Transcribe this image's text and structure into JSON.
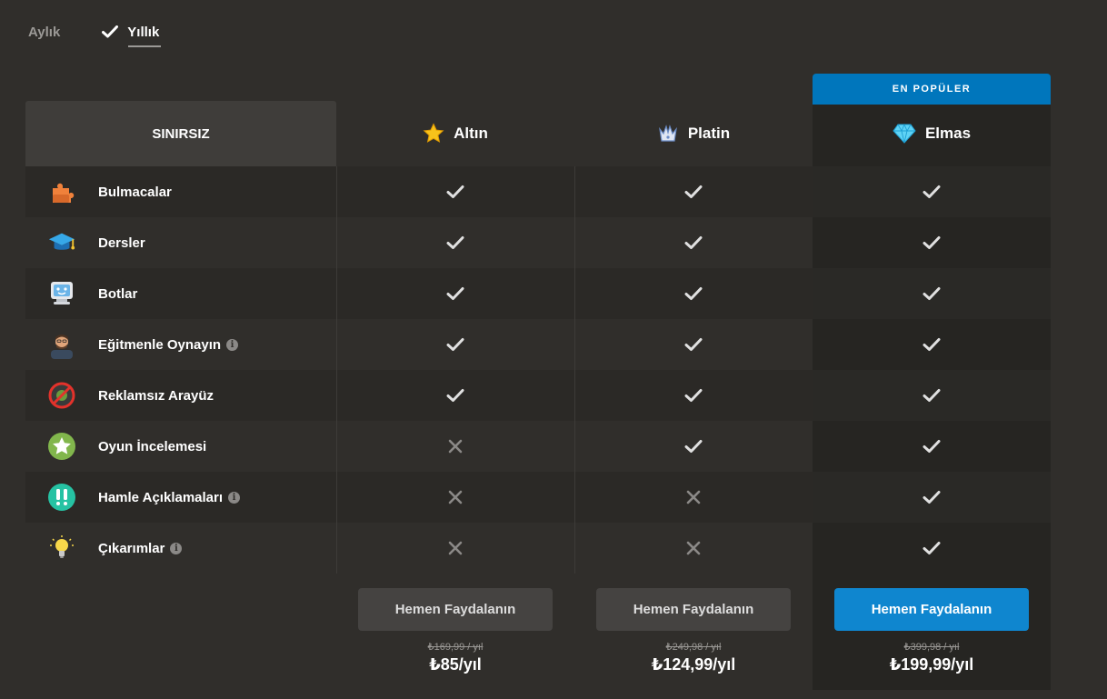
{
  "billing": {
    "monthly": "Aylık",
    "yearly": "Yıllık",
    "selected": "yearly"
  },
  "table": {
    "label_header": "SINIRSIZ",
    "popular_badge": "EN POPÜLER",
    "plans": [
      {
        "name": "Altın",
        "icon": "star-icon",
        "cta": "Hemen Faydalanın",
        "old_price": "₺169,99 / yıl",
        "price": "₺85/yıl"
      },
      {
        "name": "Platin",
        "icon": "crown-icon",
        "cta": "Hemen Faydalanın",
        "old_price": "₺249,98 / yıl",
        "price": "₺124,99/yıl"
      },
      {
        "name": "Elmas",
        "icon": "diamond-icon",
        "cta": "Hemen Faydalanın",
        "old_price": "₺399,98 / yıl",
        "price": "₺199,99/yıl"
      }
    ],
    "features": [
      {
        "label": "Bulmacalar",
        "icon": "puzzle-icon",
        "info": false,
        "gold": true,
        "plat": true,
        "dia": true
      },
      {
        "label": "Dersler",
        "icon": "graduation-cap-icon",
        "info": false,
        "gold": true,
        "plat": true,
        "dia": true
      },
      {
        "label": "Botlar",
        "icon": "robot-monitor-icon",
        "info": false,
        "gold": true,
        "plat": true,
        "dia": true
      },
      {
        "label": "Eğitmenle Oynayın",
        "icon": "coach-avatar-icon",
        "info": true,
        "gold": true,
        "plat": true,
        "dia": true
      },
      {
        "label": "Reklamsız Arayüz",
        "icon": "no-ads-icon",
        "info": false,
        "gold": true,
        "plat": true,
        "dia": true
      },
      {
        "label": "Oyun İncelemesi",
        "icon": "review-star-icon",
        "info": false,
        "gold": false,
        "plat": true,
        "dia": true
      },
      {
        "label": "Hamle Açıklamaları",
        "icon": "exclamation-icon",
        "info": true,
        "gold": false,
        "plat": false,
        "dia": true
      },
      {
        "label": "Çıkarımlar",
        "icon": "lightbulb-icon",
        "info": true,
        "gold": false,
        "plat": false,
        "dia": true
      }
    ]
  },
  "colors": {
    "background": "#302e2b",
    "accent": "#0f86cf",
    "popular": "#0076bc"
  }
}
